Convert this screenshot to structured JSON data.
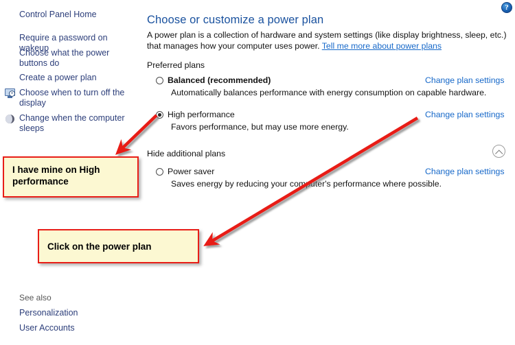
{
  "window": {
    "help_icon": "help-question-icon",
    "help_label": "?"
  },
  "sidebar": {
    "items": [
      {
        "label": "Control Panel Home",
        "icon": null
      },
      {
        "label": "Require a password on wakeup",
        "icon": null
      },
      {
        "label": "Choose what the power\nbuttons do",
        "icon": null
      },
      {
        "label": "Create a power plan",
        "icon": null
      },
      {
        "label": "Choose when to turn off the\ndisplay",
        "icon": "monitor-clock-icon"
      },
      {
        "label": "Change when the computer\nsleeps",
        "icon": "moon-sleep-icon"
      }
    ],
    "see_also": {
      "label": "See also",
      "items": [
        {
          "label": "Personalization"
        },
        {
          "label": "User Accounts"
        }
      ]
    }
  },
  "main": {
    "title": "Choose or customize a power plan",
    "description_before_link": "A power plan is a collection of hardware and system settings (like display brightness, sleep, etc.) that manages how your computer uses power. ",
    "description_link": "Tell me more about power plans",
    "groups": [
      {
        "label": "Preferred plans",
        "collapse_icon": null
      },
      {
        "label": "Hide additional plans",
        "collapse_icon": "chevron-up-circle-icon"
      }
    ],
    "plans": [
      {
        "name": "Balanced (recommended)",
        "description": "Automatically balances performance with energy consumption on capable hardware.",
        "selected": false,
        "bold": true,
        "change_link": "Change plan settings"
      },
      {
        "name": "High performance",
        "description": "Favors performance, but may use more energy.",
        "selected": true,
        "bold": false,
        "change_link": "Change plan settings"
      },
      {
        "name": "Power saver",
        "description": "Saves energy by reducing your computer's performance where possible.",
        "selected": false,
        "bold": false,
        "change_link": "Change plan settings"
      }
    ]
  },
  "annotations": {
    "accent_color": "#e81d17",
    "note_fill": "#fcf8d2",
    "callouts": [
      {
        "text": "I have mine on High\nperformance"
      },
      {
        "text": "Click on the power plan"
      }
    ],
    "arrows": [
      {
        "name": "arrow-to-high-performance-note"
      },
      {
        "name": "arrow-to-change-plan-settings-note"
      }
    ]
  },
  "colors": {
    "title_blue": "#19519e",
    "link_blue": "#1668c9",
    "nav_link": "#2c3e7a"
  }
}
